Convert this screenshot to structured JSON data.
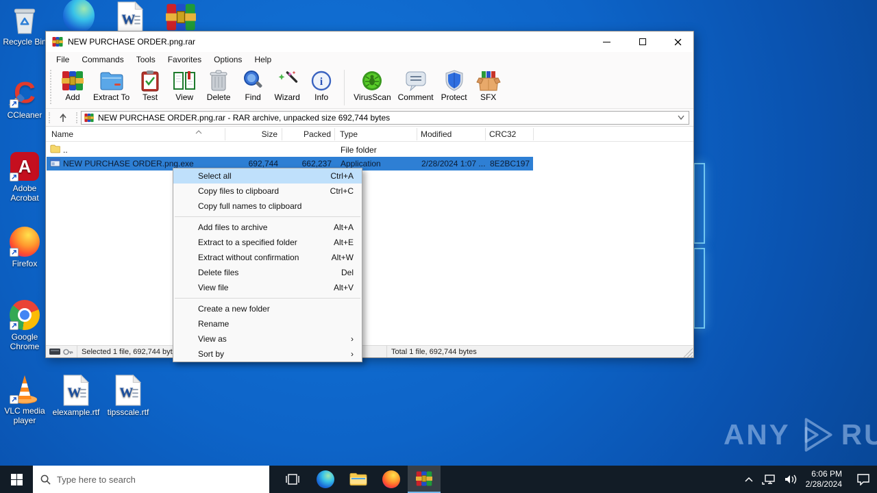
{
  "colors": {
    "desktop_blue": "#0d64c8",
    "selection_blue": "#2e7fd4",
    "menu_highlight": "#bfe0fb",
    "taskbar_bg": "#121c26",
    "active_underline": "#76b9ed"
  },
  "desktop": {
    "icons": {
      "recycle_bin": "Recycle Bin",
      "ccleaner": "CCleaner",
      "adobe": "Adobe Acrobat",
      "firefox": "Firefox",
      "chrome": "Google Chrome",
      "vlc": "VLC media player",
      "elexample": "elexample.rtf",
      "tipsscale": "tipsscale.rtf"
    },
    "watermark": {
      "left": "ANY",
      "right": "RUN"
    }
  },
  "winrar": {
    "title": "NEW PURCHASE ORDER.png.rar",
    "menu": [
      "File",
      "Commands",
      "Tools",
      "Favorites",
      "Options",
      "Help"
    ],
    "toolbar": [
      "Add",
      "Extract To",
      "Test",
      "View",
      "Delete",
      "Find",
      "Wizard",
      "Info",
      "VirusScan",
      "Comment",
      "Protect",
      "SFX"
    ],
    "address": "NEW PURCHASE ORDER.png.rar - RAR archive, unpacked size 692,744 bytes",
    "columns": [
      "Name",
      "Size",
      "Packed",
      "Type",
      "Modified",
      "CRC32"
    ],
    "rows": [
      {
        "name": "..",
        "size": "",
        "packed": "",
        "type": "File folder",
        "modified": "",
        "crc": ""
      },
      {
        "name": "NEW PURCHASE ORDER.png.exe",
        "size": "692,744",
        "packed": "662,237",
        "type": "Application",
        "modified": "2/28/2024 1:07 ...",
        "crc": "8E2BC197"
      }
    ],
    "status": {
      "selected": "Selected 1 file, 692,744 byt",
      "total": "Total 1 file, 692,744 bytes"
    }
  },
  "context_menu": {
    "items": [
      {
        "label": "Select all",
        "shortcut": "Ctrl+A"
      },
      {
        "label": "Copy files to clipboard",
        "shortcut": "Ctrl+C"
      },
      {
        "label": "Copy full names to clipboard",
        "shortcut": ""
      },
      {
        "label": "Add files to archive",
        "shortcut": "Alt+A"
      },
      {
        "label": "Extract to a specified folder",
        "shortcut": "Alt+E"
      },
      {
        "label": "Extract without confirmation",
        "shortcut": "Alt+W"
      },
      {
        "label": "Delete files",
        "shortcut": "Del"
      },
      {
        "label": "View file",
        "shortcut": "Alt+V"
      },
      {
        "label": "Create a new folder",
        "shortcut": ""
      },
      {
        "label": "Rename",
        "shortcut": ""
      },
      {
        "label": "View as",
        "shortcut": "",
        "arrow": "›"
      },
      {
        "label": "Sort by",
        "shortcut": "",
        "arrow": "›"
      }
    ]
  },
  "taskbar": {
    "search_placeholder": "Type here to search",
    "clock": {
      "time": "6:06 PM",
      "date": "2/28/2024"
    }
  }
}
